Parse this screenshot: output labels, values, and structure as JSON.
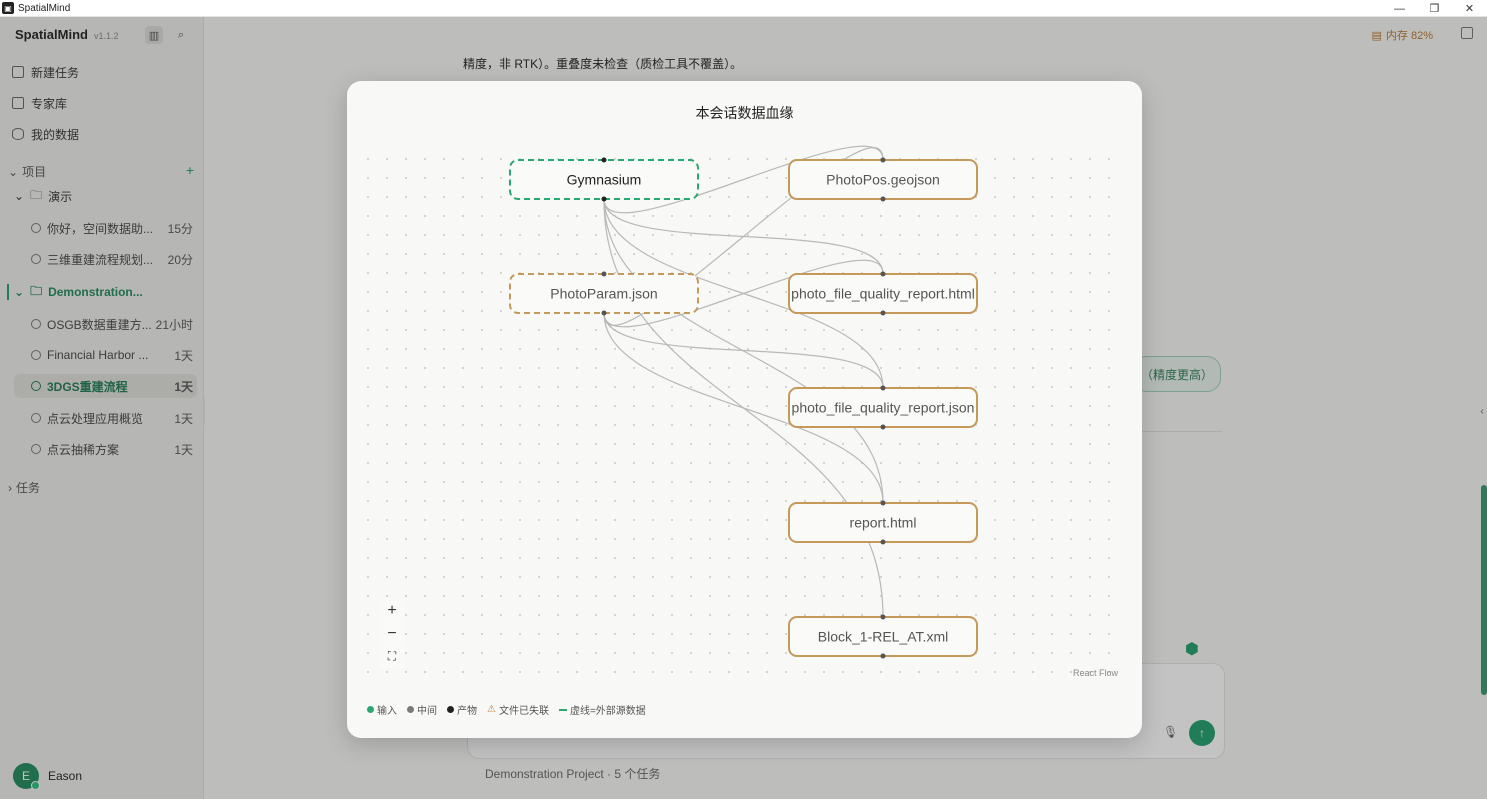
{
  "window": {
    "title": "SpatialMind",
    "icon": "app-logo-icon"
  },
  "sidebar": {
    "brand": "SpatialMind",
    "version": "v1.1.2",
    "nav": [
      {
        "label": "新建任务",
        "icon": "new-task-icon"
      },
      {
        "label": "专家库",
        "icon": "expert-library-icon"
      },
      {
        "label": "我的数据",
        "icon": "database-icon"
      }
    ],
    "projects_label": "项目",
    "tasks_label": "任务",
    "folders": [
      {
        "label": "演示",
        "chats": [
          {
            "name": "你好，空间数据助...",
            "time": "15分"
          },
          {
            "name": "三维重建流程规划...",
            "time": "20分"
          }
        ]
      },
      {
        "label": "Demonstration...",
        "chats": [
          {
            "name": "OSGB数据重建方...",
            "time": "21小时"
          },
          {
            "name": "Financial Harbor ...",
            "time": "1天"
          },
          {
            "name": "3DGS重建流程",
            "time": "1天"
          },
          {
            "name": "点云处理应用概览",
            "time": "1天"
          },
          {
            "name": "点云抽稀方案",
            "time": "1天"
          }
        ]
      }
    ],
    "user": {
      "initial": "E",
      "name": "Eason"
    }
  },
  "main": {
    "memory": "内存 82%",
    "bg_text": "精度，非 RTK）。重叠度未检查（质检工具不覆盖）。",
    "bg_pill": "（精度更高）",
    "bg_project": "Demonstration Project · 5 个任务"
  },
  "modal": {
    "title": "本会话数据血缘",
    "nodes": [
      {
        "id": "gym",
        "label": "Gymnasium",
        "kind": "input"
      },
      {
        "id": "param",
        "label": "PhotoParam.json",
        "kind": "input-external"
      },
      {
        "id": "pos",
        "label": "PhotoPos.geojson",
        "kind": "output"
      },
      {
        "id": "qhtml",
        "label": "photo_file_quality_report.html",
        "kind": "output"
      },
      {
        "id": "qjson",
        "label": "photo_file_quality_report.json",
        "kind": "output"
      },
      {
        "id": "report",
        "label": "report.html",
        "kind": "output"
      },
      {
        "id": "block",
        "label": "Block_1-REL_AT.xml",
        "kind": "output"
      }
    ],
    "edges": [
      [
        "gym",
        "pos"
      ],
      [
        "gym",
        "qhtml"
      ],
      [
        "gym",
        "qjson"
      ],
      [
        "gym",
        "report"
      ],
      [
        "gym",
        "block"
      ],
      [
        "param",
        "pos"
      ],
      [
        "param",
        "qhtml"
      ],
      [
        "param",
        "qjson"
      ],
      [
        "param",
        "report"
      ]
    ],
    "zoom_in": "+",
    "zoom_out": "−",
    "fit": "⛶",
    "attribution": "React Flow",
    "legend": {
      "input": "输入",
      "intermediate": "中间",
      "output": "产物",
      "lost": "文件已失联",
      "dashed": "虚线=外部源数据"
    },
    "colors": {
      "input": "#2aa872",
      "intermediate": "#7a7a7a",
      "output": "#222222",
      "node_border": "#c4995a",
      "warning": "#c0812c"
    }
  }
}
